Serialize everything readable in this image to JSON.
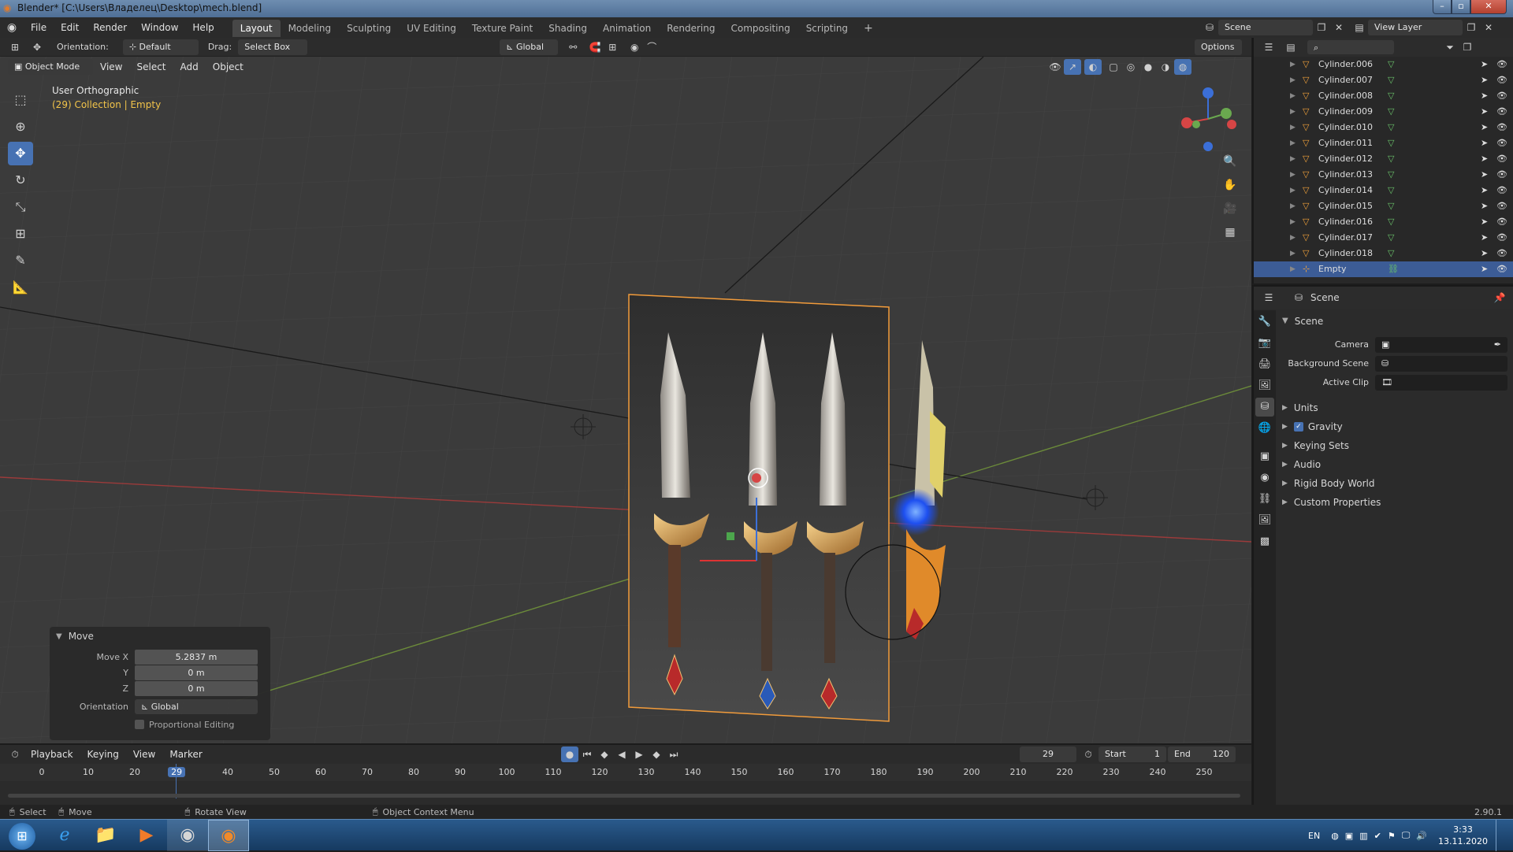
{
  "window": {
    "title": "Blender* [C:\\Users\\Владелец\\Desktop\\mech.blend]"
  },
  "menubar": {
    "menus": [
      "File",
      "Edit",
      "Render",
      "Window",
      "Help"
    ],
    "workspaces": [
      "Layout",
      "Modeling",
      "Sculpting",
      "UV Editing",
      "Texture Paint",
      "Shading",
      "Animation",
      "Rendering",
      "Compositing",
      "Scripting"
    ],
    "scene_label": "Scene",
    "view_layer_label": "View Layer"
  },
  "tool_header": {
    "orientation_label": "Orientation:",
    "orientation_value": "Default",
    "drag_label": "Drag:",
    "drag_value": "Select Box",
    "transform_orientation": "Global",
    "options_label": "Options"
  },
  "viewport_header": {
    "mode": "Object Mode",
    "menus": [
      "View",
      "Select",
      "Add",
      "Object"
    ]
  },
  "viewport": {
    "view_name": "User Orthographic",
    "collection_info": "(29) Collection | Empty"
  },
  "toolbar": {
    "tools": [
      "select-box",
      "cursor",
      "move",
      "rotate",
      "scale",
      "transform",
      "annotate",
      "measure"
    ]
  },
  "move_panel": {
    "title": "Move",
    "rows": [
      {
        "label": "Move X",
        "value": "5.2837 m"
      },
      {
        "label": "Y",
        "value": "0 m"
      },
      {
        "label": "Z",
        "value": "0 m"
      }
    ],
    "orientation_label": "Orientation",
    "orientation_value": "Global",
    "proportional_label": "Proportional Editing"
  },
  "outliner": {
    "items": [
      {
        "name": "Cylinder.006"
      },
      {
        "name": "Cylinder.007"
      },
      {
        "name": "Cylinder.008"
      },
      {
        "name": "Cylinder.009"
      },
      {
        "name": "Cylinder.010"
      },
      {
        "name": "Cylinder.011"
      },
      {
        "name": "Cylinder.012"
      },
      {
        "name": "Cylinder.013"
      },
      {
        "name": "Cylinder.014"
      },
      {
        "name": "Cylinder.015"
      },
      {
        "name": "Cylinder.016"
      },
      {
        "name": "Cylinder.017"
      },
      {
        "name": "Cylinder.018"
      },
      {
        "name": "Empty",
        "selected": true
      }
    ]
  },
  "properties": {
    "header_label": "Scene",
    "section_title": "Scene",
    "fields": [
      {
        "label": "Camera"
      },
      {
        "label": "Background Scene"
      },
      {
        "label": "Active Clip"
      }
    ],
    "subpanels": [
      "Units",
      "Gravity",
      "Keying Sets",
      "Audio",
      "Rigid Body World",
      "Custom Properties"
    ],
    "gravity_checked": true
  },
  "timeline": {
    "menus": [
      "Playback",
      "Keying",
      "View",
      "Marker"
    ],
    "current_frame": "29",
    "start_label": "Start",
    "start_value": "1",
    "end_label": "End",
    "end_value": "120",
    "ruler": [
      "0",
      "10",
      "20",
      "29",
      "40",
      "50",
      "60",
      "70",
      "80",
      "90",
      "100",
      "110",
      "120",
      "130",
      "140",
      "150",
      "160",
      "170",
      "180",
      "190",
      "200",
      "210",
      "220",
      "230",
      "240",
      "250"
    ]
  },
  "statusbar": {
    "select_label": "Select",
    "move_label": "Move",
    "rotate_label": "Rotate View",
    "context_label": "Object Context Menu",
    "version": "2.90.1"
  },
  "taskbar": {
    "lang": "EN",
    "time": "3:33",
    "date": "13.11.2020"
  },
  "colors": {
    "accent": "#4772b3",
    "selection_outline": "#f19b3b",
    "header": "#2b2b2b",
    "viewport": "#3b3b3b"
  }
}
